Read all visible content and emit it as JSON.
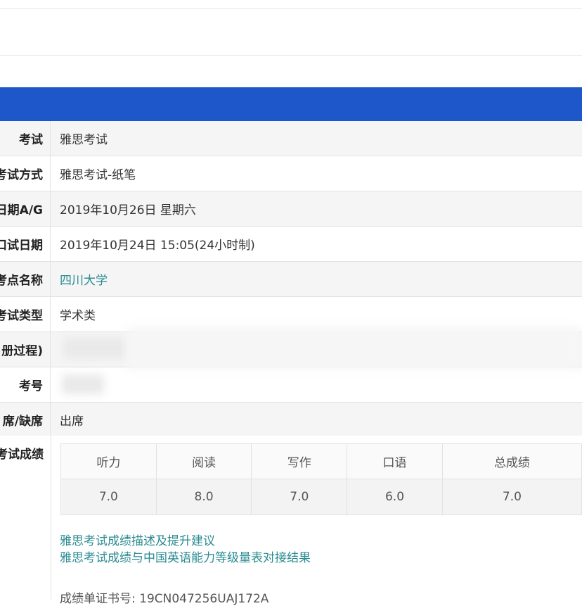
{
  "rows": [
    {
      "label": "考试",
      "value": "雅思考试"
    },
    {
      "label": "考试方式",
      "value": "雅思考试-纸笔"
    },
    {
      "label": "日期A/G",
      "value": "2019年10月26日 星期六"
    },
    {
      "label": "口试日期",
      "value": "2019年10月24日 15:05(24小时制)"
    },
    {
      "label": "考点名称",
      "value": "四川大学"
    },
    {
      "label": "考试类型",
      "value": "学术类"
    },
    {
      "label": "册过程)",
      "value": ""
    },
    {
      "label": "考号",
      "value": ""
    },
    {
      "label": "席/缺席",
      "value": "出席"
    }
  ],
  "scores": {
    "label": "考试成绩",
    "headers": [
      "听力",
      "阅读",
      "写作",
      "口语",
      "总成绩"
    ],
    "values": [
      "7.0",
      "8.0",
      "7.0",
      "6.0",
      "7.0"
    ]
  },
  "links": [
    "雅思考试成绩描述及提升建议",
    "雅思考试成绩与中国英语能力等级量表对接结果"
  ],
  "certificate": "成绩单证书号: 19CN047256UAJ172A",
  "colors": {
    "header_bar": "#1d57c9",
    "link": "#2a8b92"
  }
}
